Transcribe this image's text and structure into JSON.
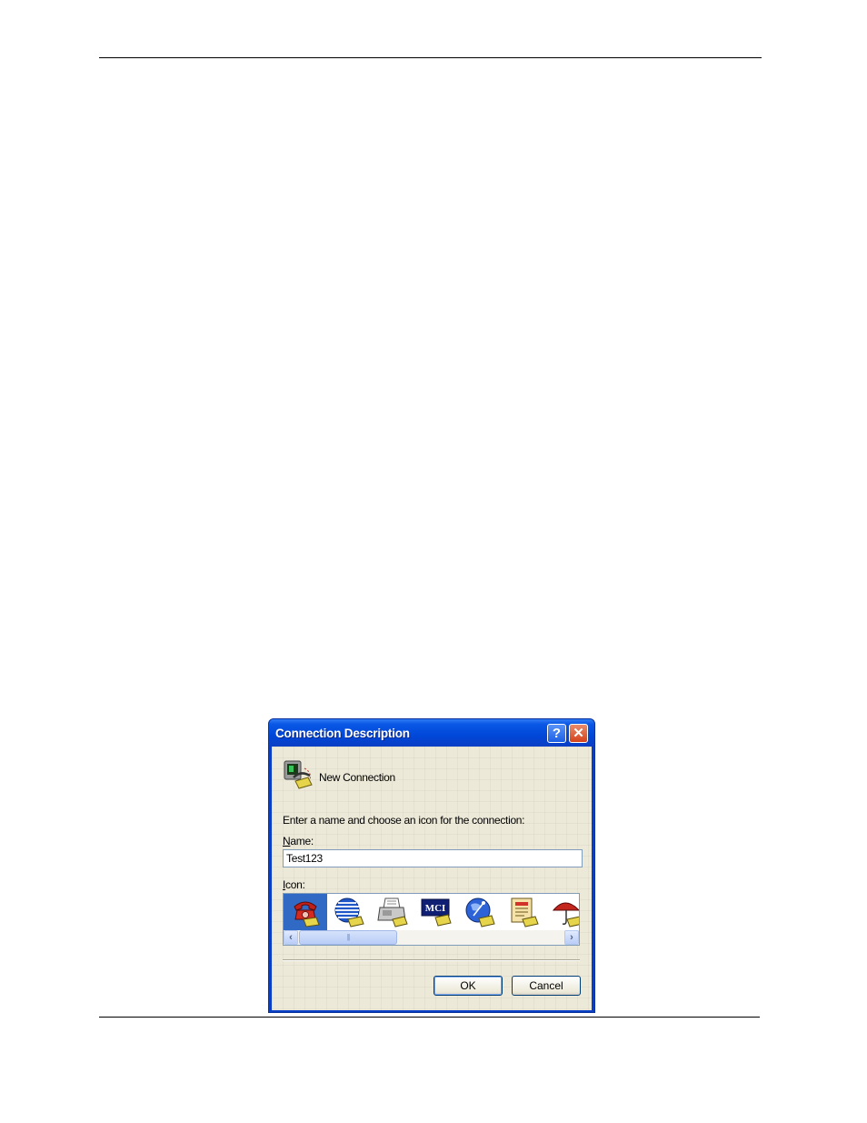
{
  "dialog": {
    "title": "Connection Description",
    "help_glyph": "?",
    "close_glyph": "✕",
    "connection_icon": "phone-terminal-icon",
    "connection_name": "New Connection",
    "instruction": "Enter a name and choose an icon for the connection:",
    "name_label_accesskey": "N",
    "name_label_rest": "ame:",
    "name_value": "Test123",
    "icon_label_accesskey": "I",
    "icon_label_rest": "con:",
    "icons": [
      {
        "name": "red-phone-icon",
        "selected": true
      },
      {
        "name": "globe-phone-icon",
        "selected": false
      },
      {
        "name": "fax-machine-icon",
        "selected": false
      },
      {
        "name": "mci-phone-icon",
        "selected": false
      },
      {
        "name": "satellite-globe-icon",
        "selected": false
      },
      {
        "name": "notepad-phone-icon",
        "selected": false
      },
      {
        "name": "umbrella-phone-icon",
        "selected": false
      }
    ],
    "icon_labels": {
      "mci": "MCI"
    },
    "scroll_left_glyph": "‹",
    "scroll_right_glyph": "›",
    "scroll_thumb_grip": "|||",
    "ok_label": "OK",
    "cancel_label": "Cancel"
  }
}
